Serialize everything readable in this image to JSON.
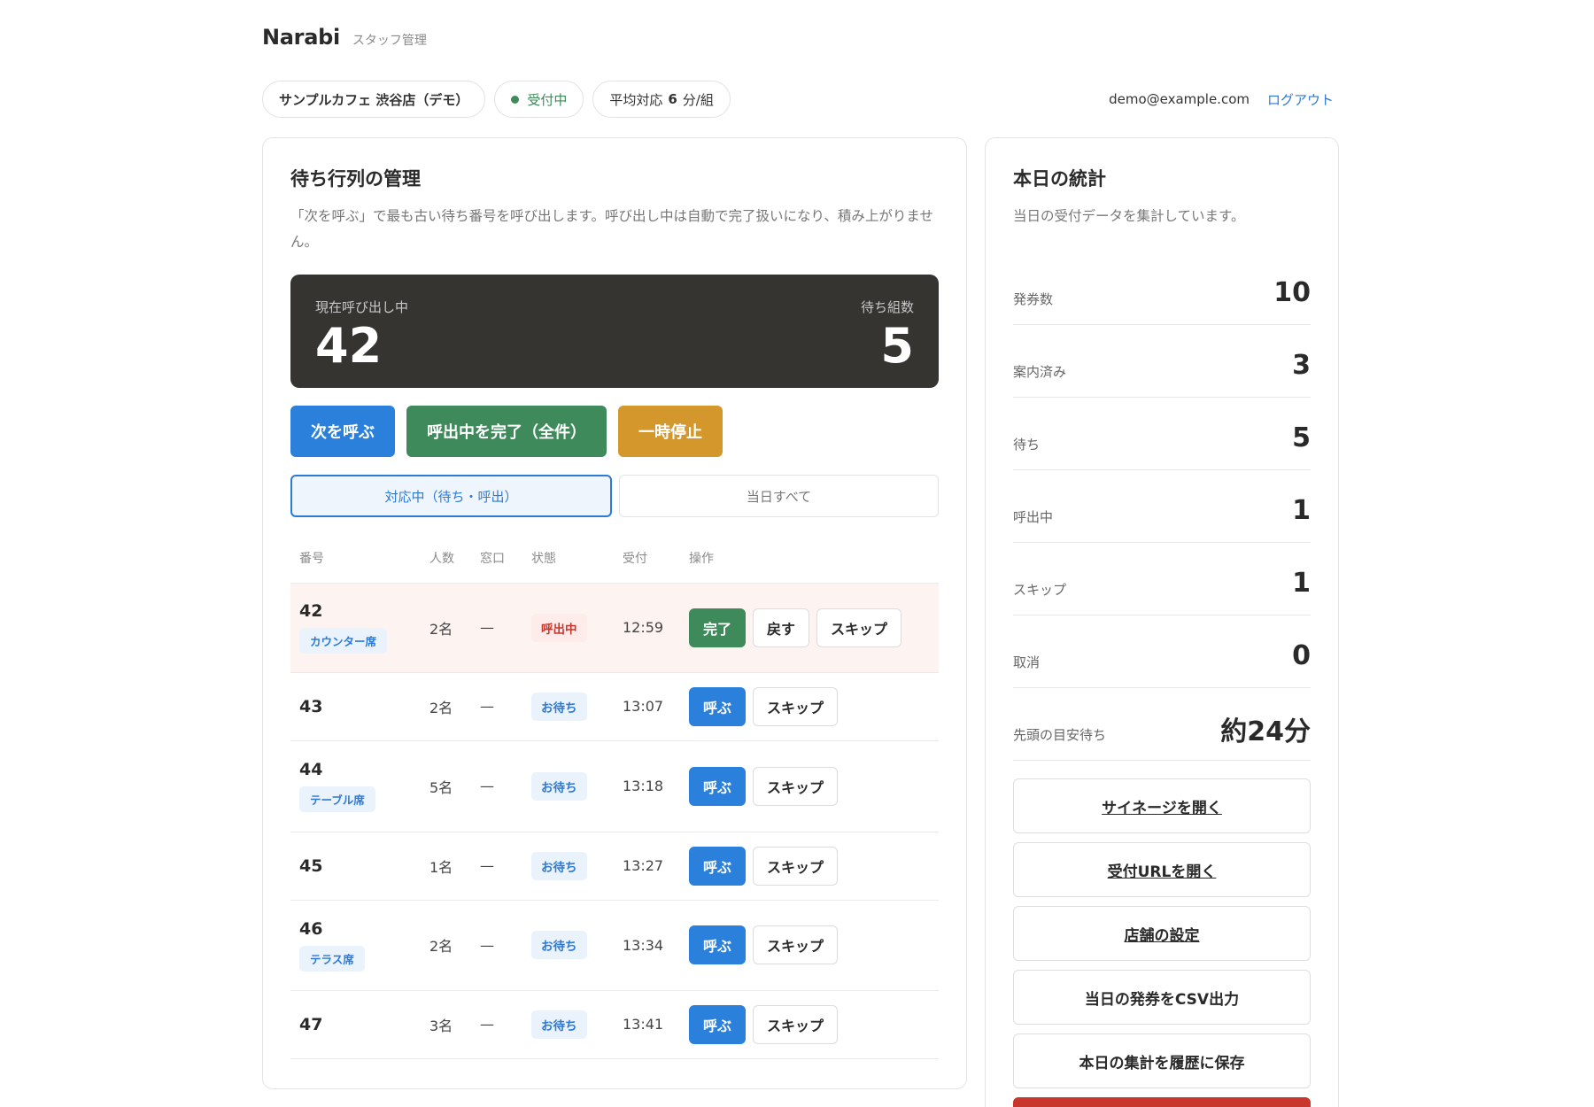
{
  "header": {
    "brand": "Narabi",
    "subtitle": "スタッフ管理"
  },
  "topbar": {
    "store": "サンプルカフェ 渋谷店（デモ）",
    "status": "受付中",
    "avg_prefix": "平均対応",
    "avg_value": "6",
    "avg_suffix": "分/組",
    "email": "demo@example.com",
    "logout": "ログアウト"
  },
  "queue": {
    "title": "待ち行列の管理",
    "desc": "「次を呼ぶ」で最も古い待ち番号を呼び出します。呼び出し中は自動で完了扱いになり、積み上がりません。",
    "now_label": "現在呼び出し中",
    "now_value": "42",
    "waiting_label": "待ち組数",
    "waiting_value": "5",
    "buttons": {
      "next": "次を呼ぶ",
      "complete_all": "呼出中を完了（全件）",
      "pause": "一時停止"
    },
    "tabs": {
      "active": "対応中（待ち・呼出）",
      "all": "当日すべて"
    },
    "columns": [
      "番号",
      "人数",
      "窓口",
      "状態",
      "受付",
      "操作"
    ],
    "rows": [
      {
        "num": "42",
        "seat": "カウンター席",
        "people": "2名",
        "window": "—",
        "status": "呼出中",
        "time": "12:59",
        "ops": [
          "完了",
          "戻す",
          "スキップ"
        ]
      },
      {
        "num": "43",
        "seat": "",
        "people": "2名",
        "window": "—",
        "status": "お待ち",
        "time": "13:07",
        "ops": [
          "呼ぶ",
          "スキップ"
        ]
      },
      {
        "num": "44",
        "seat": "テーブル席",
        "people": "5名",
        "window": "—",
        "status": "お待ち",
        "time": "13:18",
        "ops": [
          "呼ぶ",
          "スキップ"
        ]
      },
      {
        "num": "45",
        "seat": "",
        "people": "1名",
        "window": "—",
        "status": "お待ち",
        "time": "13:27",
        "ops": [
          "呼ぶ",
          "スキップ"
        ]
      },
      {
        "num": "46",
        "seat": "テラス席",
        "people": "2名",
        "window": "—",
        "status": "お待ち",
        "time": "13:34",
        "ops": [
          "呼ぶ",
          "スキップ"
        ]
      },
      {
        "num": "47",
        "seat": "",
        "people": "3名",
        "window": "—",
        "status": "お待ち",
        "time": "13:41",
        "ops": [
          "呼ぶ",
          "スキップ"
        ]
      }
    ]
  },
  "stats": {
    "title": "本日の統計",
    "desc": "当日の受付データを集計しています。",
    "items": [
      {
        "label": "発券数",
        "value": "10"
      },
      {
        "label": "案内済み",
        "value": "3"
      },
      {
        "label": "待ち",
        "value": "5"
      },
      {
        "label": "呼出中",
        "value": "1"
      },
      {
        "label": "スキップ",
        "value": "1"
      },
      {
        "label": "取消",
        "value": "0"
      },
      {
        "label": "先頭の目安待ち",
        "value": "約24分"
      }
    ],
    "links": {
      "signage": "サイネージを開く",
      "reception_url": "受付URLを開く",
      "store_settings": "店舗の設定",
      "csv_export": "当日の発券をCSV出力",
      "save_history": "本日の集計を履歴に保存"
    }
  },
  "colors": {
    "accent": "#2b80dc",
    "success": "#3e8a5b",
    "warning": "#d4972c",
    "danger": "#c9362c",
    "dark_panel": "#353431"
  }
}
